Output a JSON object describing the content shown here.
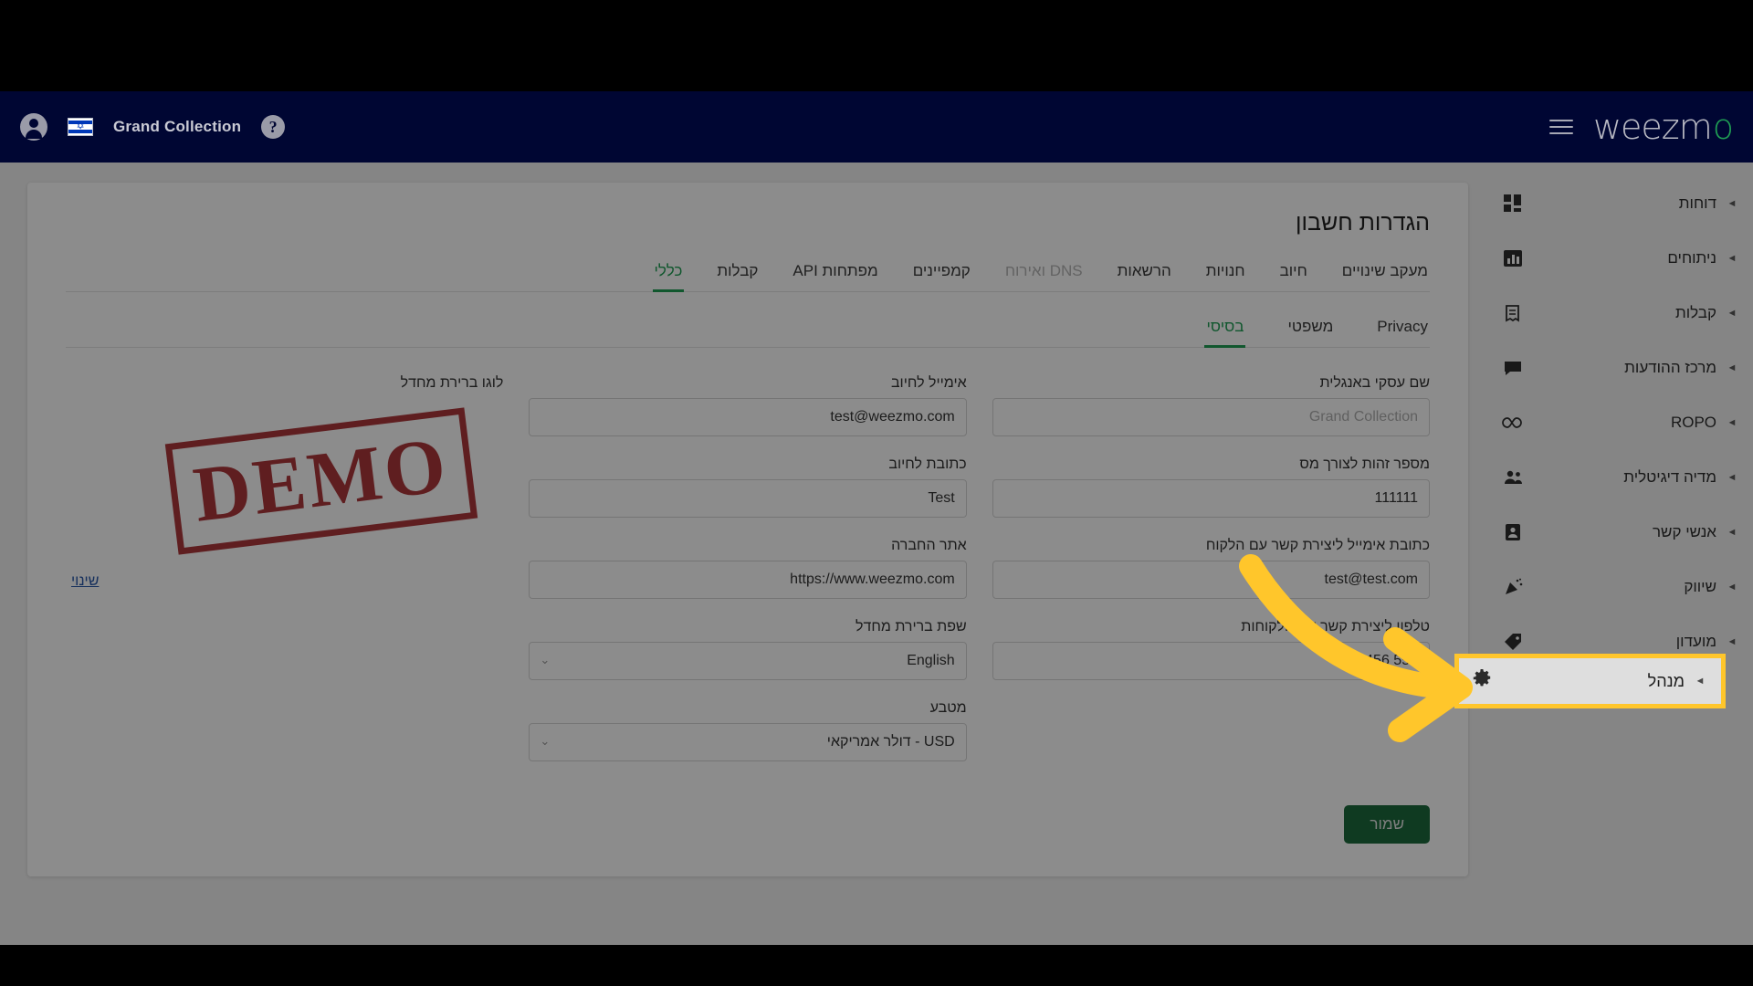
{
  "header": {
    "company_name": "Grand Collection",
    "avatar_icon": "account-circle-icon",
    "flag_icon": "israel-flag-icon",
    "help_icon": "question-mark-icon",
    "menu_icon": "hamburger-menu-icon",
    "brand": "weezm",
    "brand_accent": "o",
    "brand_color": "#1f9e54"
  },
  "sidebar": {
    "items": [
      {
        "label": "דוחות",
        "icon": "dashboard-icon",
        "glyph": "▮▮",
        "caret": "◄"
      },
      {
        "label": "ניתוחים",
        "icon": "bar-chart-icon",
        "glyph": "▦",
        "caret": "◄"
      },
      {
        "label": "קבלות",
        "icon": "receipt-icon",
        "glyph": "🧾",
        "caret": "◄"
      },
      {
        "label": "מרכז ההודעות",
        "icon": "message-icon",
        "glyph": "▬",
        "caret": "◄"
      },
      {
        "label": "ROPO",
        "icon": "infinity-icon",
        "glyph": "∞",
        "caret": "◄"
      },
      {
        "label": "מדיה דיגיטלית",
        "icon": "people-group-icon",
        "glyph": "👥",
        "caret": "◄"
      },
      {
        "label": "אנשי קשר",
        "icon": "contact-card-icon",
        "glyph": "▤",
        "caret": "◄"
      },
      {
        "label": "שיווק",
        "icon": "megaphone-icon",
        "glyph": "📣",
        "caret": "◄"
      },
      {
        "label": "מועדון",
        "icon": "tag-icon",
        "glyph": "🏷",
        "caret": "◄"
      }
    ],
    "highlighted_item": {
      "label": "מנהל",
      "icon": "gear-icon",
      "glyph": "⚙",
      "caret": "◄",
      "highlight_color": "#ffc62b"
    }
  },
  "main": {
    "title": "הגדרות חשבון",
    "tabs": [
      {
        "label": "מעקב שינויים",
        "state": "normal"
      },
      {
        "label": "חיוב",
        "state": "normal"
      },
      {
        "label": "חנויות",
        "state": "normal"
      },
      {
        "label": "הרשאות",
        "state": "normal"
      },
      {
        "label": "DNS ואירוח",
        "state": "disabled"
      },
      {
        "label": "קמפיינים",
        "state": "normal"
      },
      {
        "label": "מפתחות API",
        "state": "normal"
      },
      {
        "label": "קבלות",
        "state": "normal"
      },
      {
        "label": "כללי",
        "state": "active"
      }
    ],
    "subtabs": [
      {
        "label": "Privacy",
        "state": "normal"
      },
      {
        "label": "משפטי",
        "state": "normal"
      },
      {
        "label": "בסיסי",
        "state": "active"
      }
    ],
    "fields": {
      "business_name_en": {
        "label": "שם עסקי באנגלית",
        "value": "",
        "placeholder": "Grand Collection"
      },
      "tax_id": {
        "label": "מספר זהות לצורך מס",
        "value": "111111",
        "placeholder": ""
      },
      "contact_email": {
        "label": "כתובת אימייל ליצירת קשר עם הלקוח",
        "value": "test@test.com",
        "placeholder": ""
      },
      "contact_phone": {
        "label": "טלפון ליצירת קשר עם הלקוחות",
        "value": "555 123456",
        "placeholder": ""
      },
      "billing_email": {
        "label": "אימייל לחיוב",
        "value": "test@weezmo.com",
        "placeholder": ""
      },
      "billing_address": {
        "label": "כתובת לחיוב",
        "value": "Test",
        "placeholder": ""
      },
      "company_website": {
        "label": "אתר החברה",
        "value": "https://www.weezmo.com",
        "placeholder": ""
      },
      "default_language": {
        "label": "שפת ברירת מחדל",
        "value": "English",
        "placeholder": ""
      },
      "currency": {
        "label": "מטבע",
        "value": "USD - דולר אמריקאי",
        "placeholder": ""
      }
    },
    "logo": {
      "label": "לוגו ברירת מחדל",
      "stamp_text": "DEMO",
      "stamp_color": "#a21d20",
      "change_link": "שינוי"
    },
    "save_label": "שמור",
    "save_color": "#1c6b3c"
  },
  "annotation": {
    "arrow_color": "#ffc62b",
    "arrow_icon": "curved-arrow-right-icon"
  }
}
